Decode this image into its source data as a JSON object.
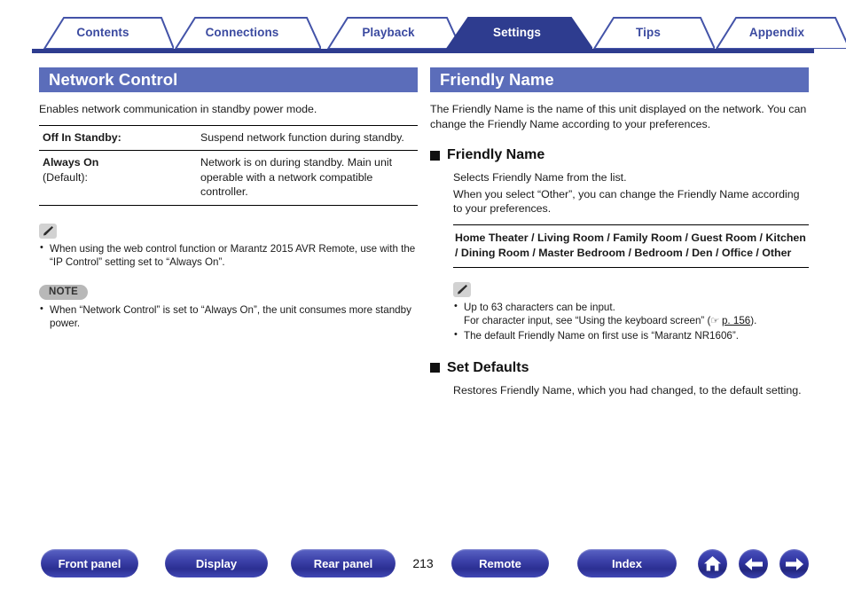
{
  "tabs": [
    {
      "label": "Contents",
      "active": false
    },
    {
      "label": "Connections",
      "active": false
    },
    {
      "label": "Playback",
      "active": false
    },
    {
      "label": "Settings",
      "active": true
    },
    {
      "label": "Tips",
      "active": false
    },
    {
      "label": "Appendix",
      "active": false
    }
  ],
  "left": {
    "header": "Network Control",
    "intro": "Enables network communication in standby power mode.",
    "table": [
      {
        "term": "Off In Standby:",
        "term_sub": "",
        "definition": "Suspend network function during standby."
      },
      {
        "term": "Always On",
        "term_sub": "(Default):",
        "definition": "Network is on during standby. Main unit operable with a network compatible controller."
      }
    ],
    "tip": {
      "icon": "pencil-icon",
      "bullets": [
        "When using the web control function or Marantz 2015 AVR Remote, use with the “IP Control” setting set to “Always On”."
      ]
    },
    "note": {
      "badge": "NOTE",
      "bullets": [
        "When “Network Control” is set to “Always On”, the unit consumes more standby power."
      ]
    }
  },
  "right": {
    "header": "Friendly Name",
    "intro": "The Friendly Name is the name of this unit displayed on the network. You can change the Friendly Name according to your preferences.",
    "sections": [
      {
        "heading": "Friendly Name",
        "paragraphs": [
          "Selects Friendly Name from the list.",
          "When you select “Other”, you can change the Friendly Name according to your preferences."
        ],
        "options": "Home Theater / Living Room / Family Room / Guest Room / Kitchen / Dining Room / Master Bedroom / Bedroom / Den / Office / Other",
        "tip": {
          "icon": "pencil-icon",
          "bullets": [
            {
              "line1": "Up to 63 characters can be input.",
              "line2_pre": "For character input, see “Using the keyboard screen” (",
              "link": "p. 156",
              "line2_post": ")."
            },
            {
              "line1": "The default Friendly Name on first use is “Marantz NR1606”.",
              "line2_pre": "",
              "link": "",
              "line2_post": ""
            }
          ]
        }
      },
      {
        "heading": "Set Defaults",
        "paragraphs": [
          "Restores Friendly Name, which you had changed, to the default setting."
        ],
        "options": "",
        "tip": null
      }
    ]
  },
  "bottom": {
    "buttons": [
      {
        "label": "Front panel"
      },
      {
        "label": "Display"
      },
      {
        "label": "Rear panel"
      },
      {
        "label": "Remote"
      },
      {
        "label": "Index"
      }
    ],
    "page_number": "213",
    "icons": [
      {
        "name": "home-icon"
      },
      {
        "name": "arrow-left-icon"
      },
      {
        "name": "arrow-right-icon"
      }
    ]
  },
  "colors": {
    "tab_bar": "#2e3c8f",
    "tab_text": "#3b4aa0",
    "section_header_bg": "#5b6dba",
    "button_blue": "#2b2f92",
    "note_badge_bg": "#b8b8b8"
  }
}
